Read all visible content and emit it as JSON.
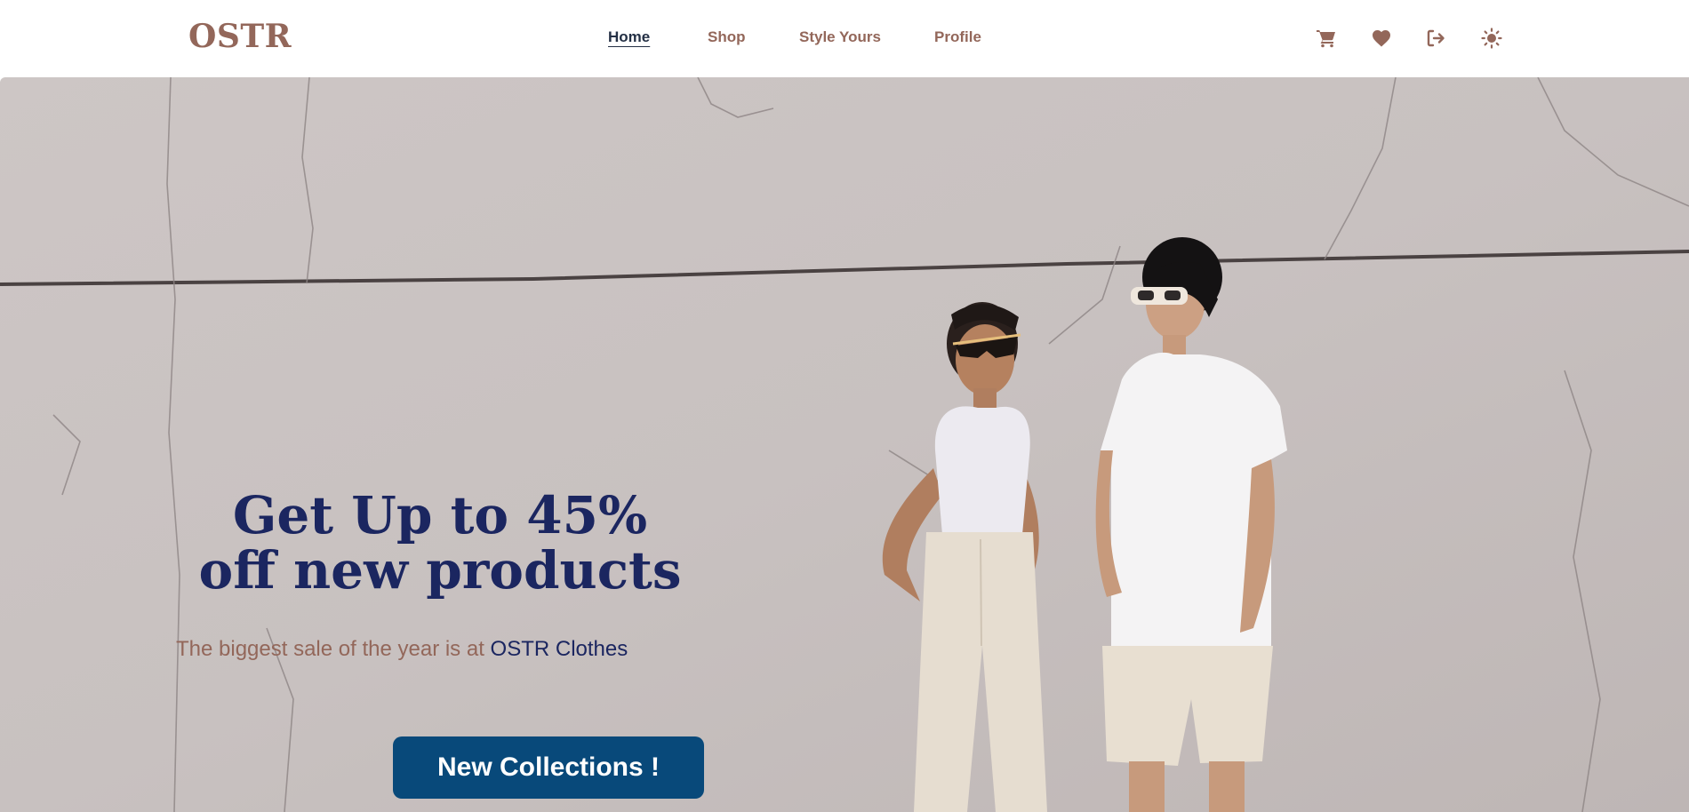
{
  "brand": {
    "name": "OSTR"
  },
  "nav": {
    "items": [
      {
        "label": "Home",
        "active": true
      },
      {
        "label": "Shop",
        "active": false
      },
      {
        "label": "Style Yours",
        "active": false
      },
      {
        "label": "Profile",
        "active": false
      }
    ]
  },
  "header_icons": [
    "cart-icon",
    "heart-icon",
    "logout-icon",
    "sun-icon"
  ],
  "hero": {
    "title_line1_prefix": "Get Up to ",
    "title_line1_highlight": "45%",
    "title_line2": "off new products",
    "subtitle_prefix": "The biggest sale of the year is at ",
    "subtitle_brand": "OSTR Clothes",
    "cta_label": "New Collections !"
  },
  "colors": {
    "brand": "#93675a",
    "navy": "#1b2660",
    "nav_active": "#243045",
    "cta_bg": "#08497a",
    "hero_bg": "#c9c2c1"
  }
}
